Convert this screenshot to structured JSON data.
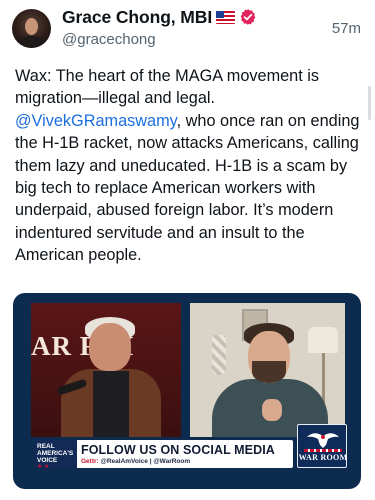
{
  "author": {
    "name": "Grace Chong, MBI",
    "flag_emoji_name": "us-flag-icon",
    "verified_icon_name": "verified-badge-icon",
    "verified_color": "#e0245e",
    "handle": "@gracechong"
  },
  "timestamp": "57m",
  "post": {
    "text_before": "Wax: The heart of the MAGA movement is migration—illegal and legal. ",
    "mention": "@VivekGRamaswamy",
    "text_after": ", who once ran on ending the H-1B racket, now attacks Americans, calling them lazy and uneducated. H-1B is a scam by big tech to replace American workers with underpaid, abused foreign labor. It’s modern indentured servitude and an insult to the American people."
  },
  "video": {
    "wall_sign": "AR R   M",
    "banner": {
      "badge_line1": "REAL",
      "badge_line2": "AMERICA'S",
      "badge_line3": "VOICE",
      "badge_stars": "★ ★",
      "title": "FOLLOW US ON SOCIAL MEDIA",
      "sub_label": "Gettr:",
      "sub_text": " @RealAmVoice | @WarRoom"
    },
    "logo_text": "WAR ROOM"
  },
  "colors": {
    "mention": "#1d6fe0",
    "secondary_text": "#536471",
    "banner_navy": "#132a57",
    "accent_red": "#c8102e"
  }
}
